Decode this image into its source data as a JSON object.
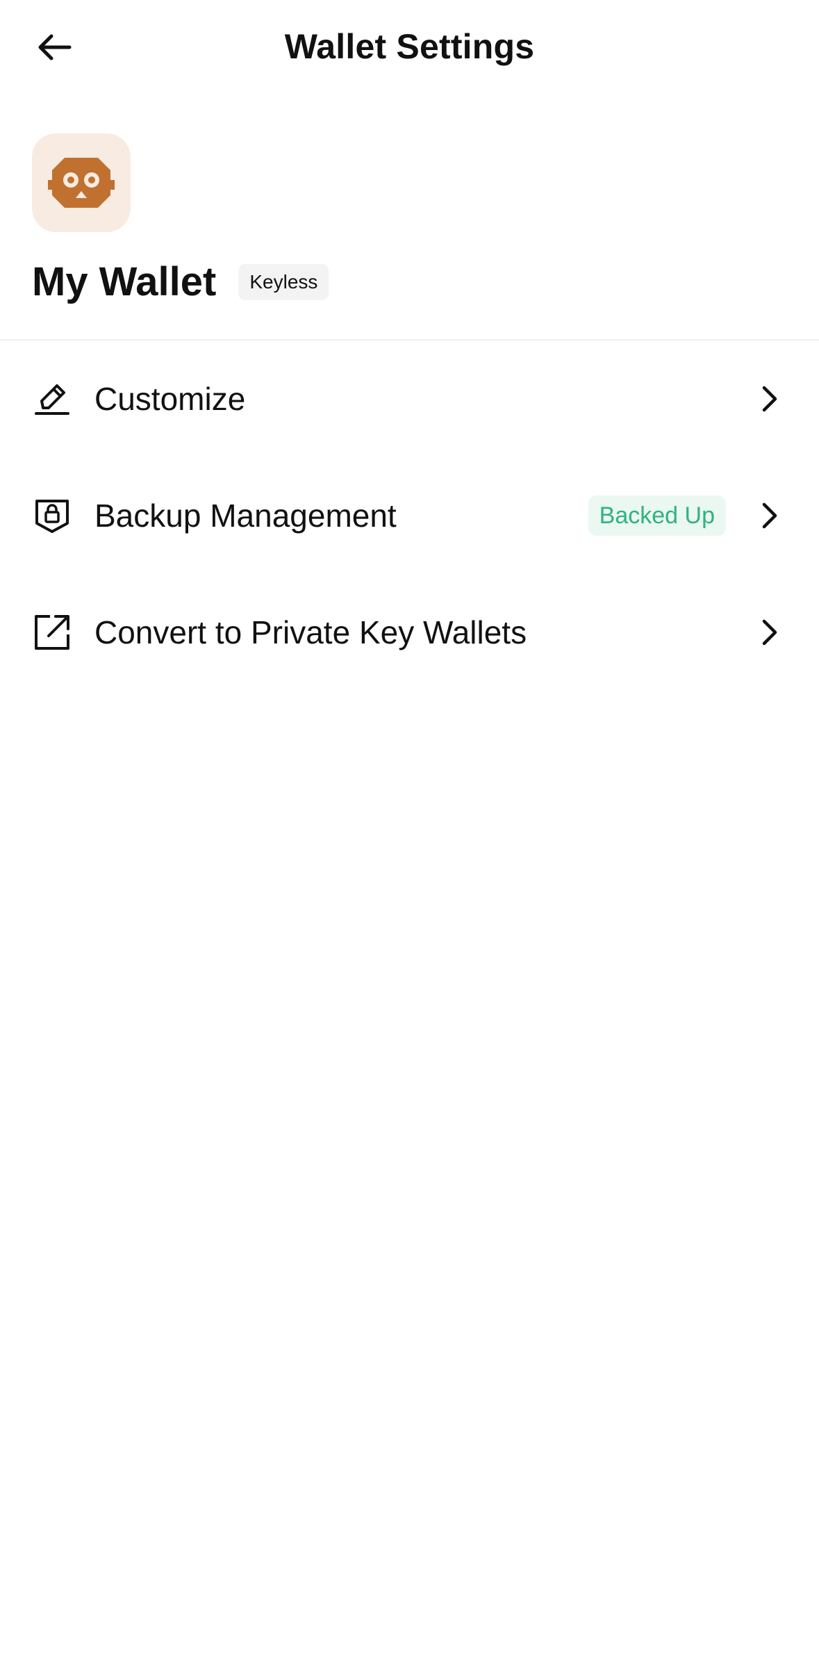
{
  "header": {
    "title": "Wallet Settings",
    "back_icon": "arrow-left-icon"
  },
  "profile": {
    "avatar_icon": "monkey-face-icon",
    "avatar_bg_color": "#f8ebe2",
    "avatar_icon_color": "#c0712f",
    "wallet_name": "My Wallet",
    "wallet_badge": "Keyless"
  },
  "menu": {
    "items": [
      {
        "label": "Customize",
        "icon": "pencil-icon",
        "status": ""
      },
      {
        "label": "Backup Management",
        "icon": "shield-lock-icon",
        "status": "Backed Up"
      },
      {
        "label": "Convert to Private Key Wallets",
        "icon": "external-link-icon",
        "status": ""
      }
    ]
  },
  "colors": {
    "status_text": "#2fb37f",
    "status_bg": "#eaf8f1"
  }
}
